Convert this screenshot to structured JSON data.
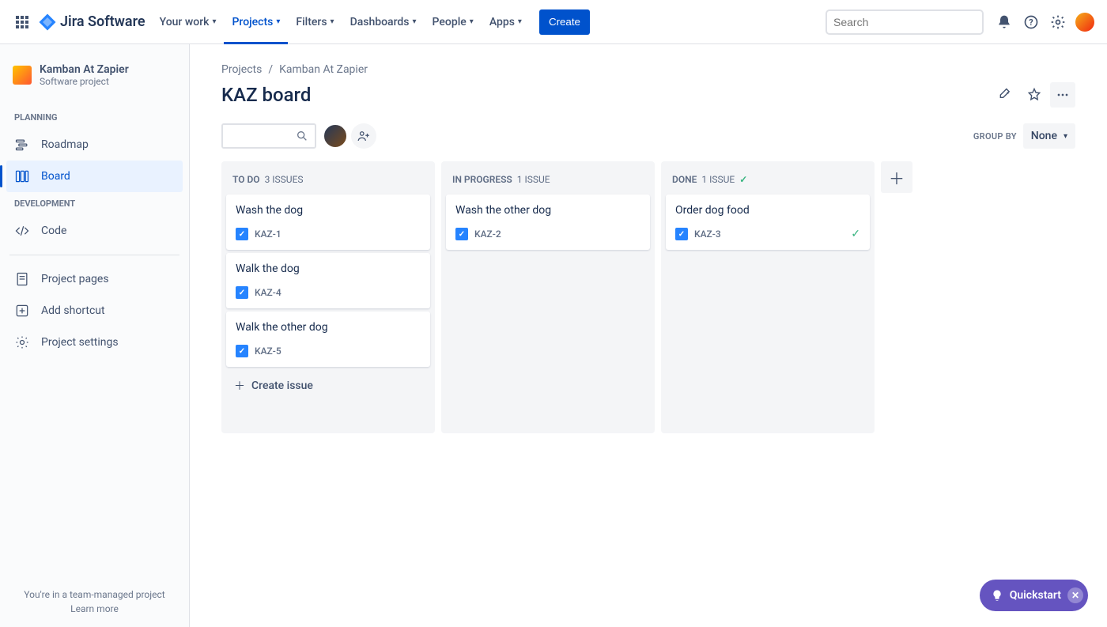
{
  "topnav": {
    "product": "Jira Software",
    "links": {
      "your_work": "Your work",
      "projects": "Projects",
      "filters": "Filters",
      "dashboards": "Dashboards",
      "people": "People",
      "apps": "Apps"
    },
    "create": "Create",
    "search_placeholder": "Search"
  },
  "sidebar": {
    "project_name": "Kamban At Zapier",
    "project_type": "Software project",
    "sections": {
      "planning": "PLANNING",
      "development": "DEVELOPMENT"
    },
    "items": {
      "roadmap": "Roadmap",
      "board": "Board",
      "code": "Code",
      "project_pages": "Project pages",
      "add_shortcut": "Add shortcut",
      "project_settings": "Project settings"
    },
    "footer_text": "You're in a team-managed project",
    "footer_link": "Learn more"
  },
  "breadcrumb": {
    "root": "Projects",
    "project": "Kamban At Zapier"
  },
  "page": {
    "title": "KAZ board",
    "group_by_label": "GROUP BY",
    "group_by_value": "None"
  },
  "columns": [
    {
      "title": "TO DO",
      "count_text": "3 ISSUES",
      "done": false,
      "cards": [
        {
          "title": "Wash the dog",
          "key": "KAZ-1"
        },
        {
          "title": "Walk the dog",
          "key": "KAZ-4"
        },
        {
          "title": "Walk the other dog",
          "key": "KAZ-5"
        }
      ],
      "show_create": true
    },
    {
      "title": "IN PROGRESS",
      "count_text": "1 ISSUE",
      "done": false,
      "cards": [
        {
          "title": "Wash the other dog",
          "key": "KAZ-2"
        }
      ],
      "show_create": false
    },
    {
      "title": "DONE",
      "count_text": "1 ISSUE",
      "done": true,
      "cards": [
        {
          "title": "Order dog food",
          "key": "KAZ-3",
          "done": true
        }
      ],
      "show_create": false
    }
  ],
  "create_issue_label": "Create issue",
  "quickstart": "Quickstart"
}
